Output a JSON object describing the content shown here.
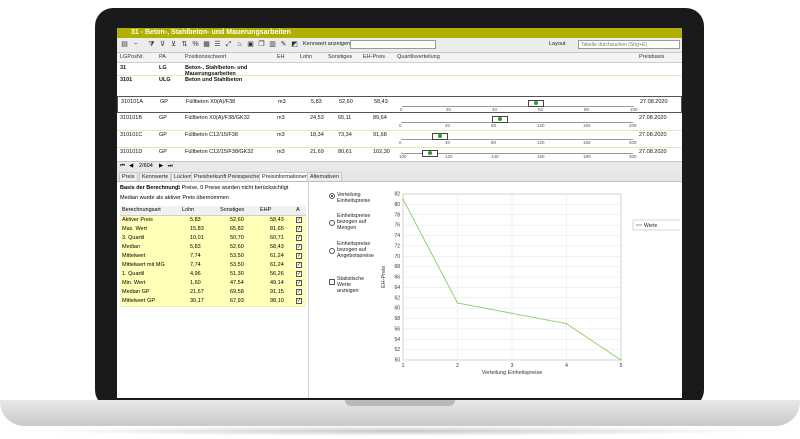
{
  "window": {
    "title": "31 - Beton-, Stahlbeton- und Mauerungsarbeiten"
  },
  "toolbar": {
    "kennwert_label": "Kennwert anzeigen",
    "kennwert_value": "",
    "layout_label": "Layout",
    "search_placeholder": "Tabelle durchsuchen (Strg+E)"
  },
  "grid": {
    "headers": [
      "LGPosNr.",
      "PA",
      "Positionsschwort",
      "EH",
      "Lohn",
      "Sonstiges",
      "EH-Preis",
      "Quartilsverteilung",
      "Preisbasis"
    ],
    "rows": [
      {
        "pos": "31",
        "pa": "LG",
        "text": "Beton-, Stahlbeton- und Mauerungsarbeiten",
        "eh": "",
        "lohn": "",
        "sonst": "",
        "ehp": "",
        "basis": "",
        "bold": true
      },
      {
        "pos": "3101",
        "pa": "ULG",
        "text": "Beton und Stahlbeton",
        "eh": "",
        "lohn": "",
        "sonst": "",
        "ehp": "",
        "basis": "",
        "bold": true
      },
      {
        "pos": "310101A",
        "pa": "GP",
        "text": "Füllbeton X0(A)/F38",
        "eh": "m3",
        "lohn": "5,83",
        "sonst": "52,60",
        "ehp": "58,43",
        "basis": "27.08.2020",
        "bold": false
      },
      {
        "pos": "310101B",
        "pa": "GP",
        "text": "Füllbeton X0(A)/F38/GK32",
        "eh": "m3",
        "lohn": "24,53",
        "sonst": "65,11",
        "ehp": "89,64",
        "basis": "27.08.2020",
        "bold": false
      },
      {
        "pos": "310101C",
        "pa": "GP",
        "text": "Füllbeton C12/15/F38",
        "eh": "m3",
        "lohn": "18,34",
        "sonst": "73,34",
        "ehp": "91,68",
        "basis": "27.08.2020",
        "bold": false
      },
      {
        "pos": "310101D",
        "pa": "GP",
        "text": "Füllbeton C12/15/F38/GK32",
        "eh": "m3",
        "lohn": "21,69",
        "sonst": "80,61",
        "ehp": "102,30",
        "basis": "27.08.2020",
        "bold": false
      }
    ],
    "axis_ticks": [
      [
        "0",
        "20",
        "40",
        "60",
        "80",
        "100"
      ],
      [
        "0",
        "40",
        "80",
        "120",
        "160",
        "200"
      ],
      [
        "0",
        "40",
        "80",
        "120",
        "160",
        "200"
      ],
      [
        "100",
        "120",
        "140",
        "160",
        "180",
        "200"
      ]
    ]
  },
  "nav": {
    "position": "2/604"
  },
  "tabs": [
    "Preis",
    "Kennwerte",
    "Lücken",
    "Preisherkunft Preisspeicher",
    "Preisinformationen",
    "Alternativen"
  ],
  "info": {
    "basis_label": "Basis der Berechnung:",
    "basis_text": "5 Preise, 0 Preise wurden nicht berücksichtigt",
    "median_note": "Median wurde als aktiver Preis übernommen"
  },
  "stats": {
    "headers": [
      "Berechnungsart",
      "Lohn",
      "Sonstiges",
      "EHP",
      "A"
    ],
    "rows": [
      {
        "name": "Aktiver Preis",
        "lohn": "5,83",
        "sonst": "52,60",
        "ehp": "58,43",
        "checked": true
      },
      {
        "name": "Max. Wert",
        "lohn": "15,83",
        "sonst": "65,82",
        "ehp": "81,65",
        "checked": true
      },
      {
        "name": "3. Quartil",
        "lohn": "10,01",
        "sonst": "50,70",
        "ehp": "60,71",
        "checked": true
      },
      {
        "name": "Median",
        "lohn": "5,83",
        "sonst": "52,60",
        "ehp": "58,43",
        "checked": true
      },
      {
        "name": "Mittelwert",
        "lohn": "7,74",
        "sonst": "53,50",
        "ehp": "61,24",
        "checked": true
      },
      {
        "name": "Mittelwert mit MG",
        "lohn": "7,74",
        "sonst": "53,50",
        "ehp": "61,24",
        "checked": true
      },
      {
        "name": "1. Quartil",
        "lohn": "4,96",
        "sonst": "51,30",
        "ehp": "56,26",
        "checked": true
      },
      {
        "name": "Min. Wert",
        "lohn": "1,60",
        "sonst": "47,54",
        "ehp": "49,14",
        "checked": true
      },
      {
        "name": "Median GP",
        "lohn": "21,57",
        "sonst": "69,58",
        "ehp": "91,15",
        "checked": true
      },
      {
        "name": "Mittelwert GP",
        "lohn": "30,17",
        "sonst": "67,93",
        "ehp": "98,10",
        "checked": true
      }
    ]
  },
  "options": {
    "opt1": "Verteilung Einheitspreise",
    "opt2": "Einheitspreise bezogen auf Mengen",
    "opt3": "Einheitspreise bezogen auf Angebotspreise",
    "chk": "Statistische Werte anzeigen"
  },
  "chart_data": {
    "type": "line",
    "x": [
      1,
      2,
      3,
      4,
      5
    ],
    "series": [
      {
        "name": "Werte",
        "values": [
          81,
          61,
          59,
          57,
          50
        ]
      }
    ],
    "xlabel": "Verteilung Einheitspreise",
    "ylabel": "EH-Preis",
    "xlim": [
      1,
      5
    ],
    "ylim": [
      50,
      82
    ],
    "x_ticks": [
      "1",
      "2",
      "3",
      "4",
      "5"
    ],
    "y_ticks": [
      "50",
      "52",
      "54",
      "56",
      "58",
      "60",
      "62",
      "64",
      "66",
      "68",
      "70",
      "72",
      "74",
      "76",
      "78",
      "80",
      "82"
    ],
    "grid": true,
    "legend": "right",
    "line_color": "#8fcf6f"
  }
}
